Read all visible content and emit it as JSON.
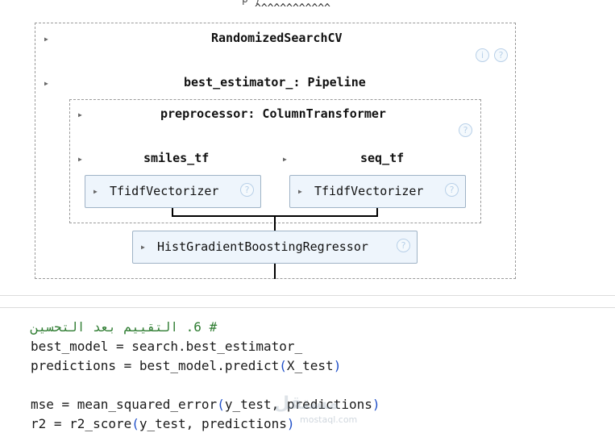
{
  "top": {
    "caret_markers": "^^^^^^^^^^^^",
    "clipped_text": "p )"
  },
  "diagram": {
    "search": {
      "title": "RandomizedSearchCV",
      "info_icon": "info-icon",
      "help_icon": "question-icon"
    },
    "best_estimator": {
      "title": "best_estimator_: Pipeline"
    },
    "preprocessor": {
      "title": "preprocessor: ColumnTransformer",
      "help_icon": "question-icon"
    },
    "branches": [
      {
        "title": "smiles_tf",
        "estimator": "TfidfVectorizer"
      },
      {
        "title": "seq_tf",
        "estimator": "TfidfVectorizer"
      }
    ],
    "regressor": {
      "estimator": "HistGradientBoostingRegressor"
    }
  },
  "code": {
    "comment": "# 6. التقييم بعد التحسين",
    "line1": "best_model = search.best_estimator_",
    "line2_a": "predictions = best_model.predict",
    "line2_b": "(",
    "line2_c": "X_test",
    "line2_d": ")",
    "line4_a": "mse = mean_squared_error",
    "line4_b": "(",
    "line4_c": "y_test, predictions",
    "line4_d": ")",
    "line5_a": "r2 = r2_score",
    "line5_b": "(",
    "line5_c": "y_test, predictions",
    "line5_d": ")"
  },
  "watermark": {
    "text": "مستقل",
    "sub": "mostaql.com"
  }
}
